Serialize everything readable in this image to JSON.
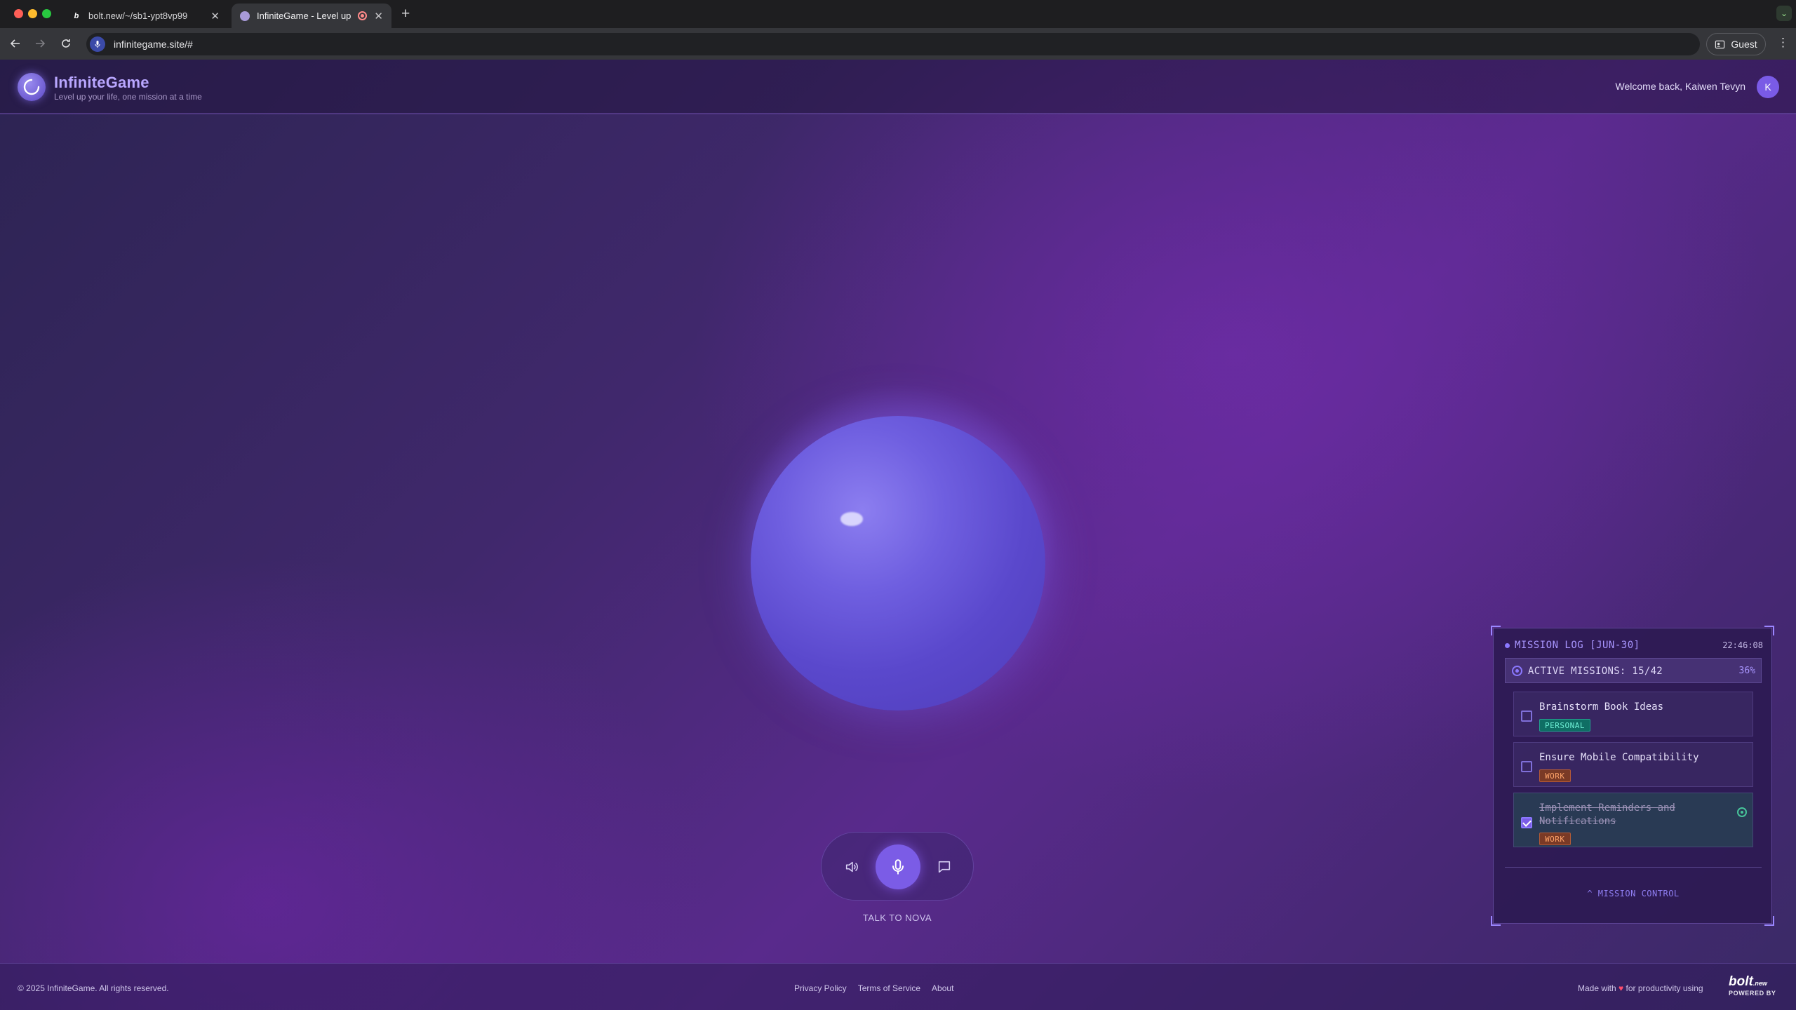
{
  "browser": {
    "tabs": [
      {
        "title": "bolt.new/~/sb1-ypt8vp99",
        "favicon": "b"
      },
      {
        "title": "InfiniteGame - Level up yo",
        "favicon": ""
      }
    ],
    "url": "infinitegame.site/#",
    "profile_label": "Guest"
  },
  "app": {
    "brand": "InfiniteGame",
    "tagline": "Level up your life, one mission at a time",
    "welcome": "Welcome back, Kaiwen Tevyn",
    "avatar_initial": "K"
  },
  "voice": {
    "talk_label": "TALK TO NOVA"
  },
  "mission_log": {
    "title": "MISSION LOG [JUN-30]",
    "time": "22:46:08",
    "active_label": "ACTIVE MISSIONS: 15/42",
    "percent": "36%",
    "tasks": [
      {
        "name": "Brainstorm Book Ideas",
        "tag": "PERSONAL",
        "done": false
      },
      {
        "name": "Ensure Mobile Compatibility",
        "tag": "WORK",
        "done": false
      },
      {
        "name": "Implement Reminders and Notifications",
        "tag": "WORK",
        "done": true
      }
    ],
    "control_label": "^ MISSION CONTROL"
  },
  "footer": {
    "copyright": "© 2025 InfiniteGame. All rights reserved.",
    "links": [
      "Privacy Policy",
      "Terms of Service",
      "About"
    ],
    "made_prefix": "Made with",
    "made_suffix": "for productivity using",
    "heart": "♥",
    "bolt_logo": "bolt",
    "bolt_logo_suffix": ".new",
    "powered_by": "POWERED BY"
  },
  "colors": {
    "accent": "#7b5ce6",
    "brand_text": "#b9a7ff",
    "tag_personal": "#0f6e64",
    "tag_work": "#7a3a26"
  }
}
